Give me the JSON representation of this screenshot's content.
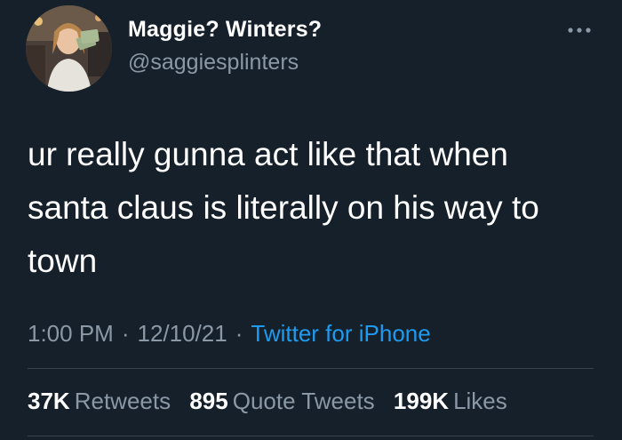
{
  "user": {
    "display_name": "Maggie? Winters?",
    "handle": "@saggiesplinters"
  },
  "tweet": {
    "text": "ur really gunna act like that when santa claus is literally on his way to town",
    "time": "1:00 PM",
    "date": "12/10/21",
    "source": "Twitter for iPhone",
    "separator": "·"
  },
  "stats": {
    "retweets_count": "37K",
    "retweets_label": "Retweets",
    "quotes_count": "895",
    "quotes_label": "Quote Tweets",
    "likes_count": "199K",
    "likes_label": "Likes"
  },
  "icons": {
    "more": "more-options-icon"
  },
  "colors": {
    "background": "#15202b",
    "primary_text": "#ffffff",
    "secondary_text": "#8b98a5",
    "link": "#1d9bf0",
    "divider": "#38444d"
  }
}
